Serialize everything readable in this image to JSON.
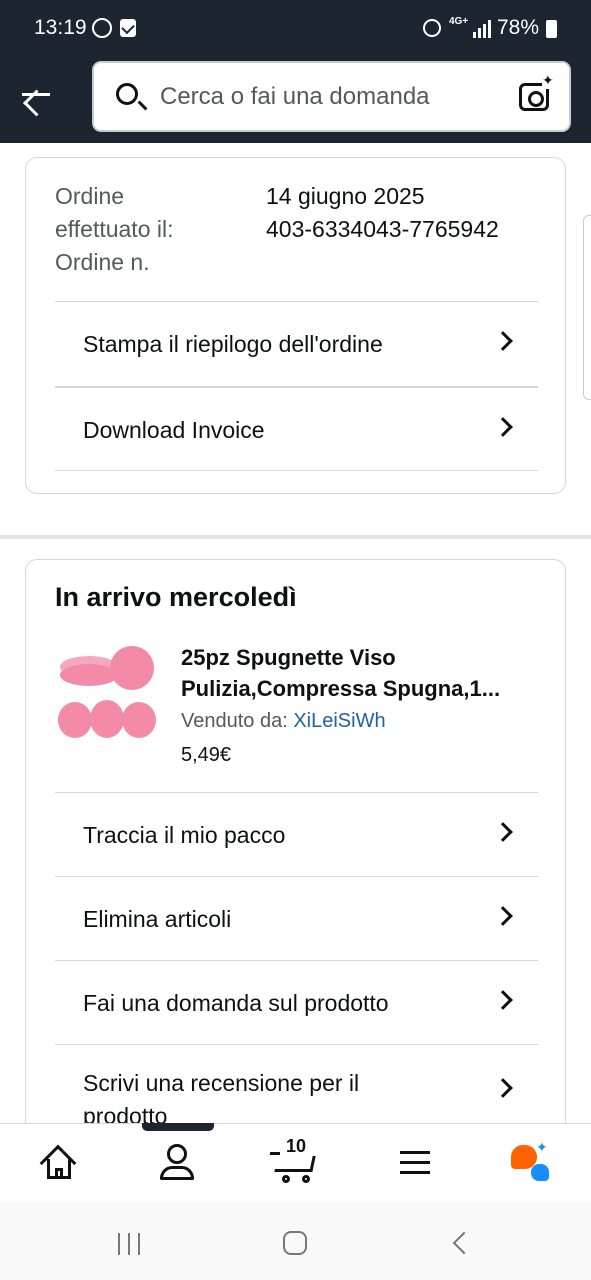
{
  "status_bar": {
    "time": "13:19",
    "network": "4G+",
    "battery": "78%"
  },
  "header": {
    "search_placeholder": "Cerca o fai una domanda",
    "background_color": "#1c2530"
  },
  "order_card": {
    "label_line1": "Ordine",
    "label_line2": "effettuato il:",
    "label_line3": "Ordine n.",
    "date": "14 giugno 2025",
    "order_number": "403-6334043-7765942",
    "actions": [
      {
        "label": "Stampa il riepilogo dell'ordine"
      },
      {
        "label": "Download Invoice"
      }
    ]
  },
  "shipment_card": {
    "heading": "In arrivo mercoledì",
    "product": {
      "title_line1": "25pz Spugnette Viso",
      "title_line2": "Pulizia,Compressa Spugna,1...",
      "seller_label": "Venduto da: ",
      "seller_name": "XiLeiSiWh",
      "price": "5,49€",
      "image_color": "#f28aa8"
    },
    "actions": [
      {
        "label": "Traccia il mio pacco"
      },
      {
        "label": "Elimina articoli"
      },
      {
        "label": "Fai una domanda sul prodotto"
      },
      {
        "label": "Scrivi una recensione per il prodotto"
      }
    ]
  },
  "tab_bar": {
    "cart_count": "10",
    "tabs": [
      "home-icon",
      "account-icon",
      "cart-icon",
      "menu-icon",
      "rufus-icon"
    ]
  },
  "colors": {
    "link": "#2162a1",
    "text": "#0f1111",
    "muted": "#565959",
    "border": "#d5d9d9"
  }
}
